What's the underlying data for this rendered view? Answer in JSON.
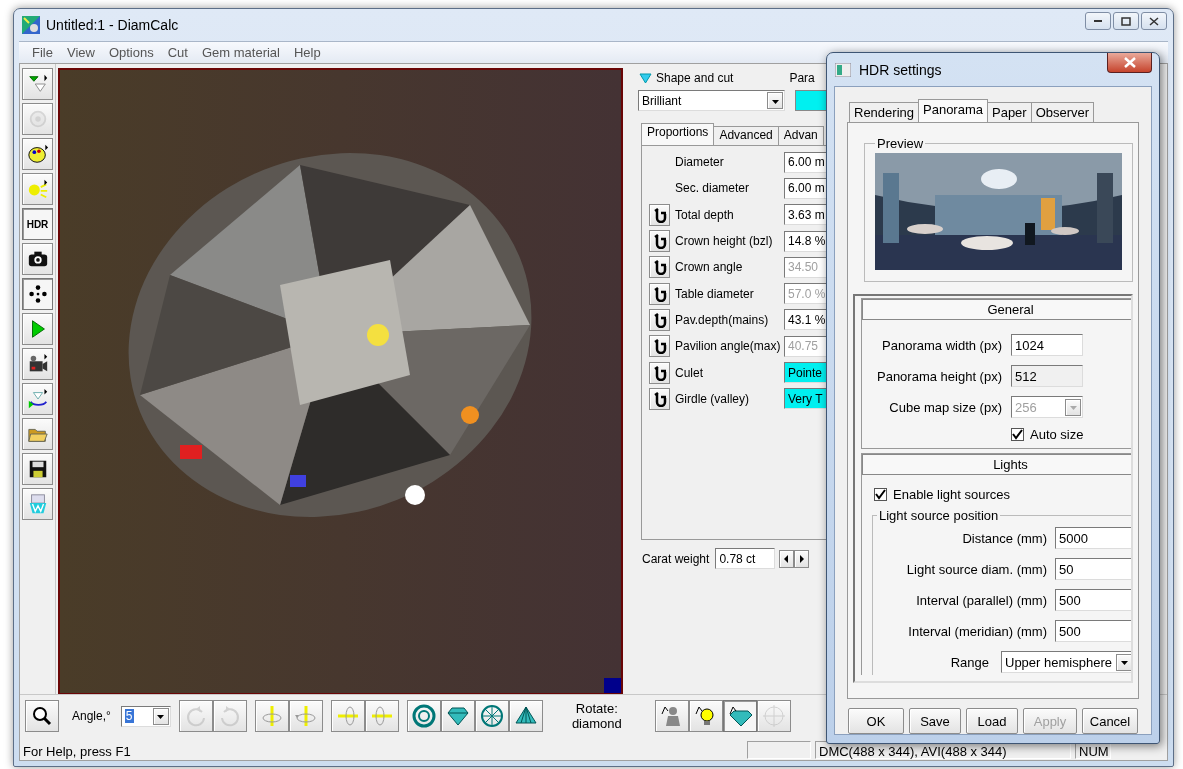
{
  "window": {
    "title": "Untitled:1 - DiamCalc"
  },
  "menu": [
    "File",
    "View",
    "Options",
    "Cut",
    "Gem material",
    "Help"
  ],
  "left_toolbar": [
    {
      "pressed": false,
      "disabled": false
    },
    {
      "pressed": false,
      "disabled": true
    },
    {
      "pressed": false,
      "disabled": false
    },
    {
      "pressed": false,
      "disabled": false
    },
    {
      "label": "HDR",
      "pressed": true,
      "disabled": false
    },
    {
      "pressed": false,
      "disabled": false
    },
    {
      "pressed": true,
      "disabled": false
    },
    {
      "pressed": false,
      "disabled": false
    },
    {
      "pressed": false,
      "disabled": false
    },
    {
      "pressed": false,
      "disabled": false
    },
    {
      "pressed": false,
      "disabled": false
    },
    {
      "pressed": false,
      "disabled": false
    },
    {
      "pressed": false,
      "disabled": false
    }
  ],
  "shape_panel": {
    "title": "Shape and cut",
    "shape": "Brilliant",
    "params_label": "Para",
    "tabs": [
      {
        "label": "Proportions",
        "selected": true
      },
      {
        "label": "Advanced",
        "selected": false
      },
      {
        "label": "Advan",
        "selected": false
      }
    ],
    "rows": [
      {
        "label": "Diameter",
        "lock": false,
        "value": "6.00 m",
        "kind": "edit",
        "disabled": false
      },
      {
        "label": "Sec. diameter",
        "lock": false,
        "value": "6.00 m",
        "kind": "edit",
        "disabled": false
      },
      {
        "label": "Total depth",
        "lock": true,
        "value": "3.63 m",
        "kind": "edit",
        "disabled": false
      },
      {
        "label": "Crown height (bzl)",
        "lock": true,
        "value": "14.8 %",
        "kind": "edit",
        "disabled": false
      },
      {
        "label": "Crown angle",
        "lock": true,
        "value": "34.50",
        "kind": "edit",
        "disabled": true
      },
      {
        "label": "Table diameter",
        "lock": true,
        "value": "57.0 %",
        "kind": "edit",
        "disabled": true
      },
      {
        "label": "Pav.depth(mains)",
        "lock": true,
        "value": "43.1 %",
        "kind": "edit",
        "disabled": false
      },
      {
        "label": "Pavilion angle(max)",
        "lock": true,
        "value": "40.75",
        "kind": "edit",
        "disabled": true
      },
      {
        "label": "Culet",
        "lock": true,
        "value": "Pointe",
        "kind": "select",
        "disabled": false
      },
      {
        "label": "Girdle (valley)",
        "lock": true,
        "value": "Very T",
        "kind": "select",
        "disabled": false
      }
    ],
    "carat_label": "Carat weight",
    "carat_value": "0.78 ct"
  },
  "bottom_toolbar": {
    "angle_label": "Angle,°",
    "angle_value": "5",
    "tools": [
      {
        "disabled": true
      },
      {
        "disabled": true
      },
      {
        "disabled": false
      },
      {
        "disabled": false
      },
      {
        "disabled": false
      },
      {
        "disabled": false
      },
      {
        "disabled": false
      },
      {
        "disabled": false
      },
      {
        "disabled": false
      },
      {
        "disabled": false
      }
    ],
    "rotate_label": "Rotate: diamond",
    "modes": [
      {
        "pressed": false,
        "disabled": false
      },
      {
        "pressed": false,
        "disabled": false
      },
      {
        "pressed": true,
        "disabled": false
      },
      {
        "pressed": false,
        "disabled": true
      }
    ]
  },
  "status_bar": {
    "help": "For Help, press F1",
    "sizes": "DMC(488 x 344), AVI(488 x 344)",
    "num": "NUM"
  },
  "dialog": {
    "title": "HDR settings",
    "tabs": [
      {
        "label": "Rendering",
        "selected": false
      },
      {
        "label": "Panorama",
        "selected": true
      },
      {
        "label": "Paper",
        "selected": false
      },
      {
        "label": "Observer",
        "selected": false
      }
    ],
    "preview_label": "Preview",
    "general": {
      "title": "General",
      "fields": [
        {
          "label": "Panorama width (px)",
          "value": "1024",
          "kind": "edit",
          "disabled": false
        },
        {
          "label": "Panorama height (px)",
          "value": "512",
          "kind": "readonly",
          "disabled": false
        },
        {
          "label": "Cube map size (px)",
          "value": "256",
          "kind": "combo",
          "disabled": true
        }
      ],
      "auto_size": {
        "label": "Auto size",
        "checked": true
      }
    },
    "lights": {
      "title": "Lights",
      "enable": {
        "label": "Enable light sources",
        "checked": true
      },
      "group": "Light source position",
      "fields": [
        {
          "label": "Distance (mm)",
          "value": "5000",
          "kind": "edit",
          "disabled": false
        },
        {
          "label": "Light source diam. (mm)",
          "value": "50",
          "kind": "edit",
          "disabled": false
        },
        {
          "label": "Interval (parallel) (mm)",
          "value": "500",
          "kind": "edit",
          "disabled": false
        },
        {
          "label": "Interval (meridian) (mm)",
          "value": "500",
          "kind": "edit",
          "disabled": false
        },
        {
          "label": "Range",
          "value": "Upper hemisphere",
          "kind": "combo",
          "disabled": false
        }
      ]
    },
    "buttons": [
      {
        "label": "OK",
        "disabled": false
      },
      {
        "label": "Save",
        "disabled": false
      },
      {
        "label": "Load",
        "disabled": false
      },
      {
        "label": "Apply",
        "disabled": true
      },
      {
        "label": "Cancel",
        "disabled": false
      }
    ]
  }
}
